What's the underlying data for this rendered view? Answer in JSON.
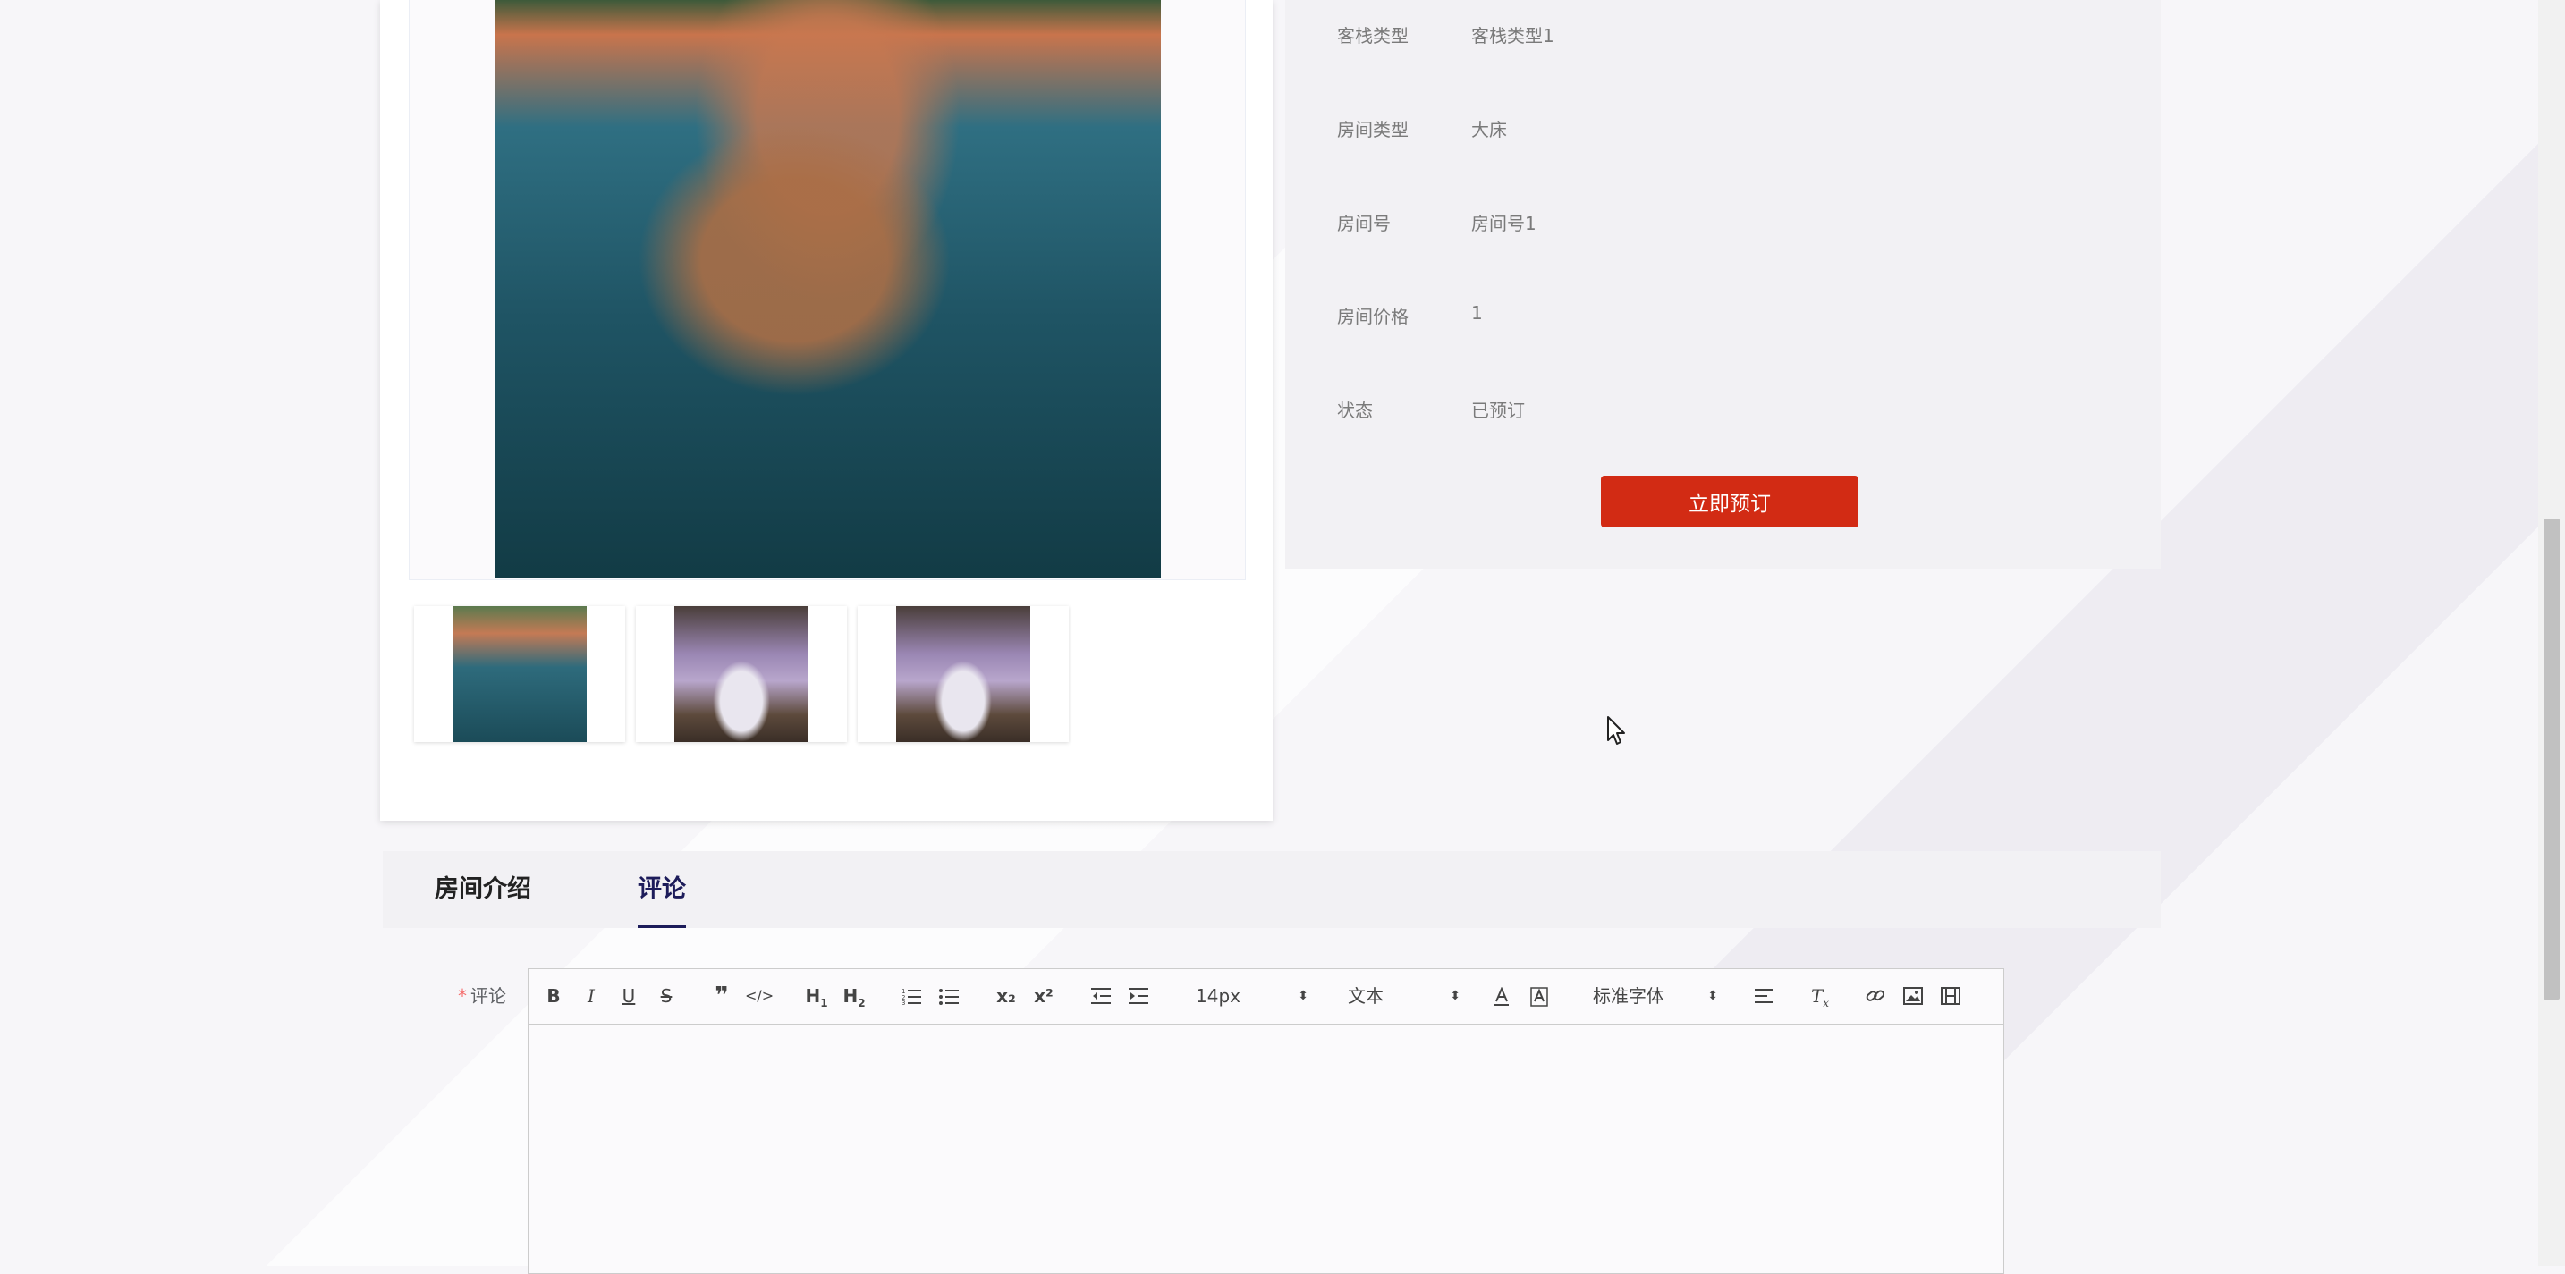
{
  "room_info": {
    "rows": [
      {
        "label": "客栈类型",
        "value": "客栈类型1"
      },
      {
        "label": "房间类型",
        "value": "大床"
      },
      {
        "label": "房间号",
        "value": "房间号1"
      },
      {
        "label": "房间价格",
        "value": "1"
      },
      {
        "label": "状态",
        "value": "已预订"
      }
    ],
    "book_button": "立即预订"
  },
  "tabs": [
    {
      "label": "房间介绍",
      "active": false
    },
    {
      "label": "评论",
      "active": true
    }
  ],
  "comment": {
    "required_mark": "*",
    "label": "评论",
    "toolbar": {
      "font_size": "14px",
      "header_select": "文本",
      "font_family": "标准字体",
      "subscript_label": "x₂",
      "superscript_label": "x²"
    }
  },
  "colors": {
    "accent_red": "#d22b14",
    "active_tab": "#1d1c5a"
  }
}
